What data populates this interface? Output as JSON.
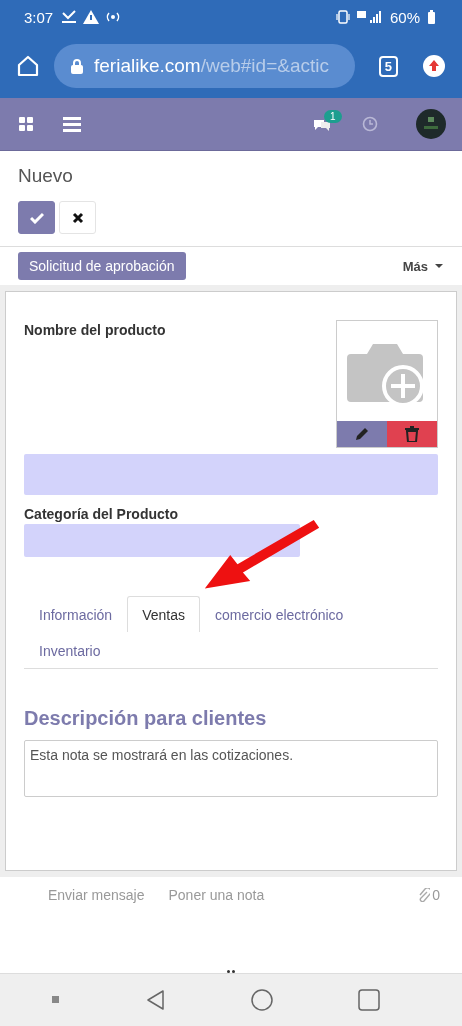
{
  "status_bar": {
    "time": "3:07",
    "battery": "60%"
  },
  "browser": {
    "url_domain": "ferialike.com",
    "url_path": "/web#id=&actic",
    "tab_count": "5"
  },
  "navbar": {
    "message_count": "1"
  },
  "breadcrumb": "Nuevo",
  "action_buttons": [
    {
      "kind": "save"
    },
    {
      "kind": "discard"
    }
  ],
  "status_button": "Solicitud de aprobación",
  "more_menu": "Más",
  "form": {
    "name_label": "Nombre del producto",
    "category_label": "Categoría del Producto",
    "tabs": [
      {
        "label": "Información",
        "selected": false
      },
      {
        "label": "Ventas",
        "selected": true
      },
      {
        "label": "comercio electrónico",
        "selected": false
      },
      {
        "label": "Inventario",
        "selected": false
      }
    ],
    "section_title": "Descripción para clientes",
    "note_placeholder": "Esta nota se mostrará en las cotizaciones."
  },
  "chatter": {
    "send_message": "Enviar mensaje",
    "log_note": "Poner una nota",
    "attachment_count": "0"
  }
}
